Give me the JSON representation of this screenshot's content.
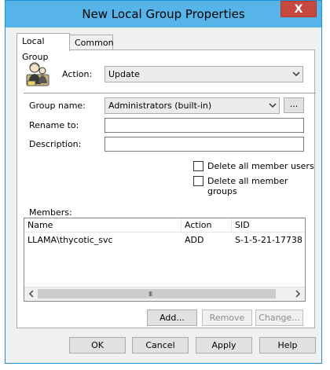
{
  "window": {
    "title": "New Local Group Properties",
    "close_glyph": "X"
  },
  "tabs": [
    {
      "label": "Local Group",
      "active": true
    },
    {
      "label": "Common",
      "active": false
    }
  ],
  "form": {
    "action_label": "Action:",
    "action_value": "Update",
    "group_name_label": "Group name:",
    "group_name_value": "Administrators (built-in)",
    "browse_label": "...",
    "rename_label": "Rename to:",
    "rename_value": "",
    "description_label": "Description:",
    "description_value": "",
    "delete_users_label": "Delete all member users",
    "delete_groups_label": "Delete all member groups",
    "delete_users_checked": false,
    "delete_groups_checked": false
  },
  "members": {
    "label": "Members:",
    "columns": [
      "Name",
      "Action",
      "SID"
    ],
    "rows": [
      {
        "name": "LLAMA\\thycotic_svc",
        "action": "ADD",
        "sid": "S-1-5-21-17738"
      }
    ],
    "scroll_grip": "III"
  },
  "member_buttons": {
    "add": "Add...",
    "remove": "Remove",
    "change": "Change..."
  },
  "footer_buttons": {
    "ok": "OK",
    "cancel": "Cancel",
    "apply": "Apply",
    "help": "Help"
  },
  "colors": {
    "titlebar": "#56b4e8",
    "close": "#c7483e",
    "window_border": "#1d8fd6"
  }
}
